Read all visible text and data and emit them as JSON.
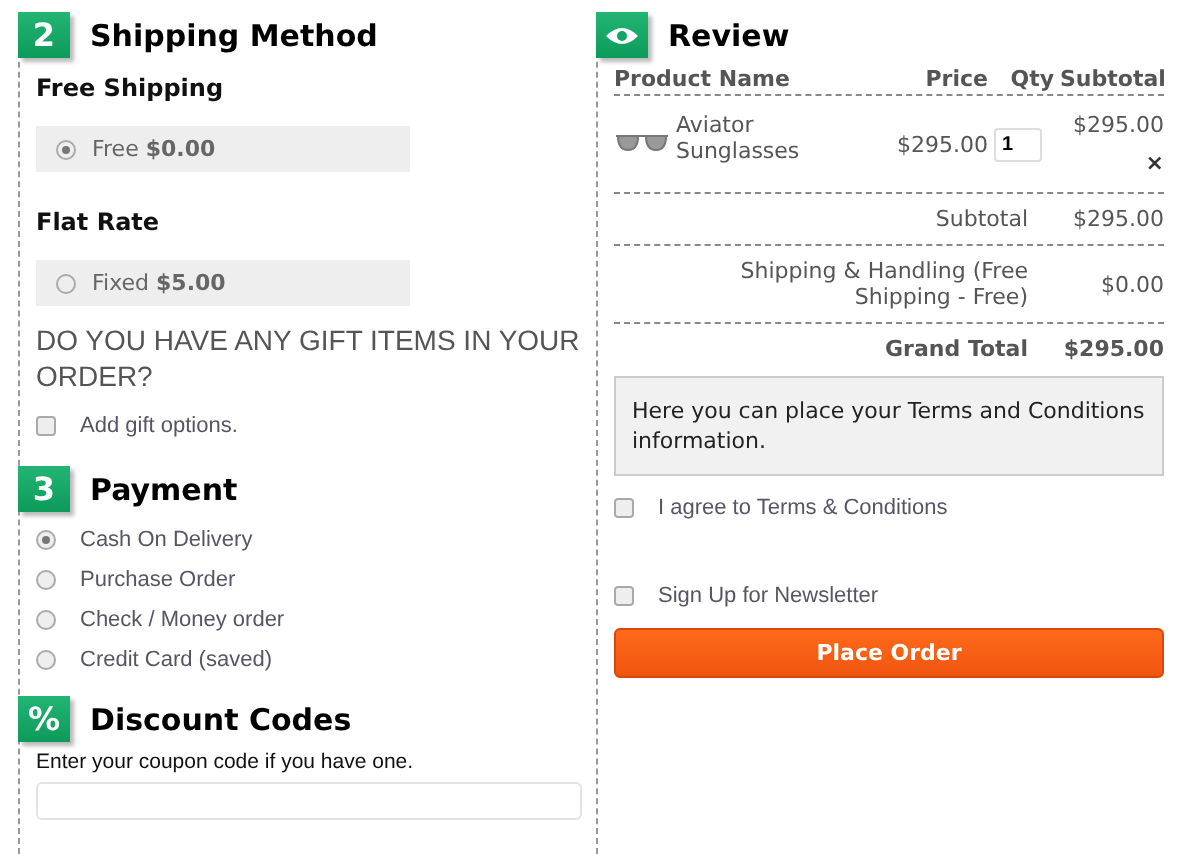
{
  "shipping": {
    "badge": "2",
    "title": "Shipping Method",
    "groups": [
      {
        "name": "Free Shipping",
        "label": "Free",
        "price": "$0.00",
        "selected": true
      },
      {
        "name": "Flat Rate",
        "label": "Fixed",
        "price": "$5.00",
        "selected": false
      }
    ],
    "gift_question": "DO YOU HAVE ANY GIFT ITEMS IN YOUR ORDER?",
    "gift_option": {
      "label": "Add gift options.",
      "checked": false
    }
  },
  "payment": {
    "badge": "3",
    "title": "Payment",
    "methods": [
      {
        "label": "Cash On Delivery",
        "selected": true
      },
      {
        "label": "Purchase Order",
        "selected": false
      },
      {
        "label": "Check / Money order",
        "selected": false
      },
      {
        "label": "Credit Card (saved)",
        "selected": false
      }
    ]
  },
  "discount": {
    "badge": "%",
    "title": "Discount Codes",
    "hint": "Enter your coupon code if you have one."
  },
  "review": {
    "title": "Review",
    "columns": [
      "Product Name",
      "Price",
      "Qty",
      "Subtotal"
    ],
    "items": [
      {
        "name": "Aviator Sunglasses",
        "price": "$295.00",
        "qty": "1",
        "subtotal": "$295.00",
        "remove": "×"
      }
    ],
    "totals": [
      {
        "label": "Subtotal",
        "value": "$295.00",
        "kind": "normal"
      },
      {
        "label": "Shipping & Handling (Free Shipping - Free)",
        "value": "$0.00",
        "kind": "normal"
      },
      {
        "label": "Grand Total",
        "value": "$295.00",
        "kind": "grand"
      }
    ],
    "terms": "Here you can place your Terms and Conditions information.",
    "agree": {
      "label": "I agree to Terms & Conditions",
      "checked": false
    },
    "newsletter": {
      "label": "Sign Up for Newsletter",
      "checked": false
    },
    "button": "Place Order"
  }
}
